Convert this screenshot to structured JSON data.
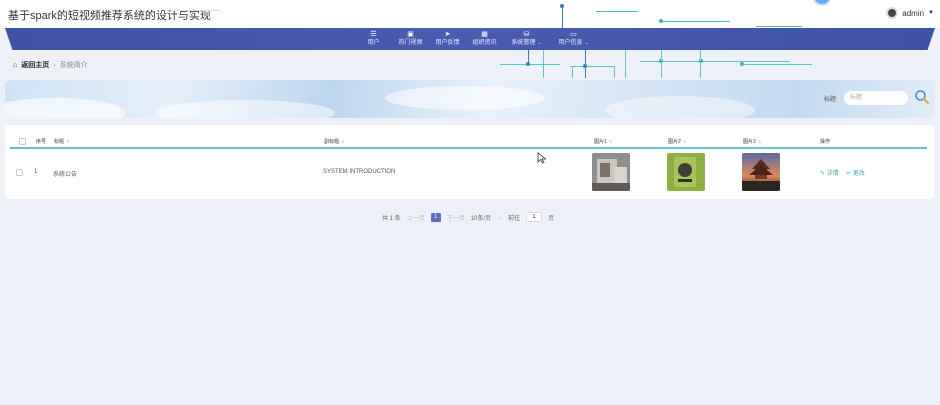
{
  "app": {
    "title": "基于spark的短视频推荐系统的设计与实现"
  },
  "user": {
    "name": "admin"
  },
  "nav": {
    "items": [
      {
        "icon": "user-icon",
        "glyph": "☰",
        "label": "用户"
      },
      {
        "icon": "video-icon",
        "glyph": "▣",
        "label": "热门视频"
      },
      {
        "icon": "send-icon",
        "glyph": "➤",
        "label": "用户反馈"
      },
      {
        "icon": "grid-icon",
        "glyph": "▦",
        "label": "组织资讯"
      },
      {
        "icon": "db-icon",
        "glyph": "⛁",
        "label": "系统管理"
      },
      {
        "icon": "card-icon",
        "glyph": "▭",
        "label": "用户信息"
      }
    ]
  },
  "breadcrumb": {
    "home": "返回主页",
    "sep": "›",
    "current": "系统简介"
  },
  "search": {
    "label": "标题",
    "placeholder": "标题"
  },
  "table": {
    "headers": {
      "index": "序号",
      "title": "标题",
      "subtitle": "副标题",
      "img1": "图片1",
      "img2": "图片2",
      "img3": "图片3",
      "ops": "操作"
    },
    "rows": [
      {
        "index": "1",
        "title": "系统公告",
        "subtitle": "SYSTEM INTRODUCTION",
        "detail": "✎ 详情",
        "edit": "✂ 更改"
      }
    ]
  },
  "pagination": {
    "total": "共 1 条",
    "prev": "上一页",
    "page": "1",
    "next": "下一页",
    "per_page": "10条/页",
    "goto": "前往",
    "goto_value": "1",
    "unit": "页"
  },
  "colors": {
    "nav": "#3f52a6",
    "accent": "#5fc4cf",
    "link": "#4aa8b4",
    "page_active": "#5f6fc0"
  }
}
